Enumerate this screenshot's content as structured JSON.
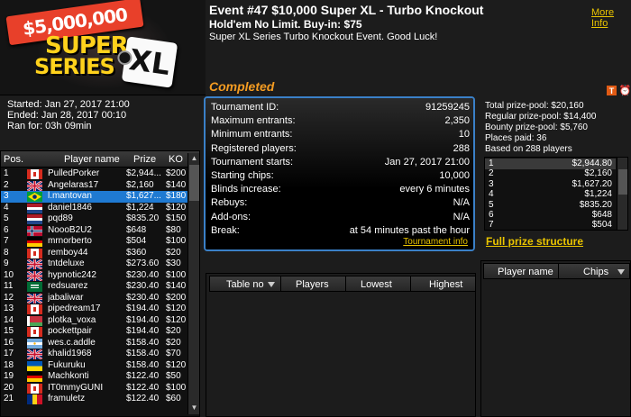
{
  "banner": {
    "tag": "$5,000,000",
    "line1": "SUPER",
    "line2": "SERIES",
    "badge": "XL"
  },
  "header": {
    "title": "Event #47 $10,000 Super XL - Turbo Knockout",
    "subtitle": "Hold'em No Limit. Buy-in: $75",
    "description": "Super XL Series Turbo Knockout Event. Good Luck!",
    "more_info": "More Info",
    "status": "Completed",
    "status_color": "#f49c22",
    "t_button": "T",
    "alarm_icon": "alarm-icon"
  },
  "times": {
    "started": "Started: Jan 27, 2017 21:00",
    "ended": "Ended: Jan 28, 2017 00:10",
    "ran_for": "Ran for: 03h 09min"
  },
  "player_table": {
    "columns": {
      "pos": "Pos.",
      "name": "Player name",
      "prize": "Prize",
      "ko": "KO"
    },
    "rows": [
      {
        "pos": "1",
        "flag": "ca",
        "name": "PulledPorker",
        "prize": "$2,944...",
        "ko": "$200"
      },
      {
        "pos": "2",
        "flag": "gb",
        "name": "Angelaras17",
        "prize": "$2,160",
        "ko": "$140"
      },
      {
        "pos": "3",
        "flag": "br",
        "name": "l.mantovan",
        "prize": "$1,627...",
        "ko": "$180"
      },
      {
        "pos": "4",
        "flag": "nl",
        "name": "daniel1846",
        "prize": "$1,224",
        "ko": "$120"
      },
      {
        "pos": "5",
        "flag": "nl",
        "name": "pqd89",
        "prize": "$835.20",
        "ko": "$150"
      },
      {
        "pos": "6",
        "flag": "no",
        "name": "NoooB2U2",
        "prize": "$648",
        "ko": "$80"
      },
      {
        "pos": "7",
        "flag": "de",
        "name": "mrnorberto",
        "prize": "$504",
        "ko": "$100"
      },
      {
        "pos": "8",
        "flag": "ca",
        "name": "remboy44",
        "prize": "$360",
        "ko": "$20"
      },
      {
        "pos": "9",
        "flag": "gb",
        "name": "tntdeluxe",
        "prize": "$273.60",
        "ko": "$30"
      },
      {
        "pos": "10",
        "flag": "gb",
        "name": "hypnotic242",
        "prize": "$230.40",
        "ko": "$100"
      },
      {
        "pos": "11",
        "flag": "sa",
        "name": "redsuarez",
        "prize": "$230.40",
        "ko": "$140"
      },
      {
        "pos": "12",
        "flag": "gb",
        "name": "jabaliwar",
        "prize": "$230.40",
        "ko": "$200"
      },
      {
        "pos": "13",
        "flag": "ca",
        "name": "pipedream17",
        "prize": "$194.40",
        "ko": "$120"
      },
      {
        "pos": "14",
        "flag": "by",
        "name": "plotka_voxa",
        "prize": "$194.40",
        "ko": "$120"
      },
      {
        "pos": "15",
        "flag": "ca",
        "name": "pockettpair",
        "prize": "$194.40",
        "ko": "$20"
      },
      {
        "pos": "16",
        "flag": "ar",
        "name": "wes.c.addle",
        "prize": "$158.40",
        "ko": "$20"
      },
      {
        "pos": "17",
        "flag": "gb",
        "name": "khalid1968",
        "prize": "$158.40",
        "ko": "$70"
      },
      {
        "pos": "18",
        "flag": "ua",
        "name": "Fukuruku",
        "prize": "$158.40",
        "ko": "$120"
      },
      {
        "pos": "19",
        "flag": "de",
        "name": "Machkonti",
        "prize": "$122.40",
        "ko": "$50"
      },
      {
        "pos": "20",
        "flag": "ca",
        "name": "IT0mmyGUNI",
        "prize": "$122.40",
        "ko": "$100"
      },
      {
        "pos": "21",
        "flag": "ro",
        "name": "framuletz",
        "prize": "$122.40",
        "ko": "$60"
      }
    ]
  },
  "tournament_info": {
    "rows": [
      {
        "k": "Tournament ID:",
        "v": "91259245"
      },
      {
        "k": "Maximum entrants:",
        "v": "2,350"
      },
      {
        "k": "Minimum entrants:",
        "v": "10"
      },
      {
        "k": "Registered players:",
        "v": "288"
      },
      {
        "k": "Tournament starts:",
        "v": "Jan 27, 2017 21:00"
      },
      {
        "k": "Starting chips:",
        "v": "10,000"
      },
      {
        "k": "Blinds increase:",
        "v": "every 6 minutes"
      },
      {
        "k": "Rebuys:",
        "v": "N/A"
      },
      {
        "k": "Add-ons:",
        "v": "N/A"
      },
      {
        "k": "Break:",
        "v": "at 54 minutes past the hour"
      }
    ],
    "link": "Tournament info"
  },
  "prize_pool": {
    "total": "Total prize-pool: $20,160",
    "regular": "Regular prize-pool: $14,400",
    "bounty": "Bounty prize-pool: $5,760",
    "places": "Places paid: 36",
    "based": "Based on 288 players",
    "rows": [
      {
        "k": "1",
        "v": "$2,944.80"
      },
      {
        "k": "2",
        "v": "$2,160"
      },
      {
        "k": "3",
        "v": "$1,627.20"
      },
      {
        "k": "4",
        "v": "$1,224"
      },
      {
        "k": "5",
        "v": "$835.20"
      },
      {
        "k": "6",
        "v": "$648"
      },
      {
        "k": "7",
        "v": "$504"
      }
    ],
    "full_link": "Full prize structure"
  },
  "tables_panel": {
    "columns": {
      "table_no": "Table no",
      "players": "Players",
      "lowest": "Lowest",
      "highest": "Highest"
    }
  },
  "players_panel": {
    "columns": {
      "name": "Player name",
      "chips": "Chips"
    }
  },
  "colors": {
    "accent": "#e9c400",
    "selection": "#1f7ad2",
    "info_border": "#3a80c8"
  }
}
